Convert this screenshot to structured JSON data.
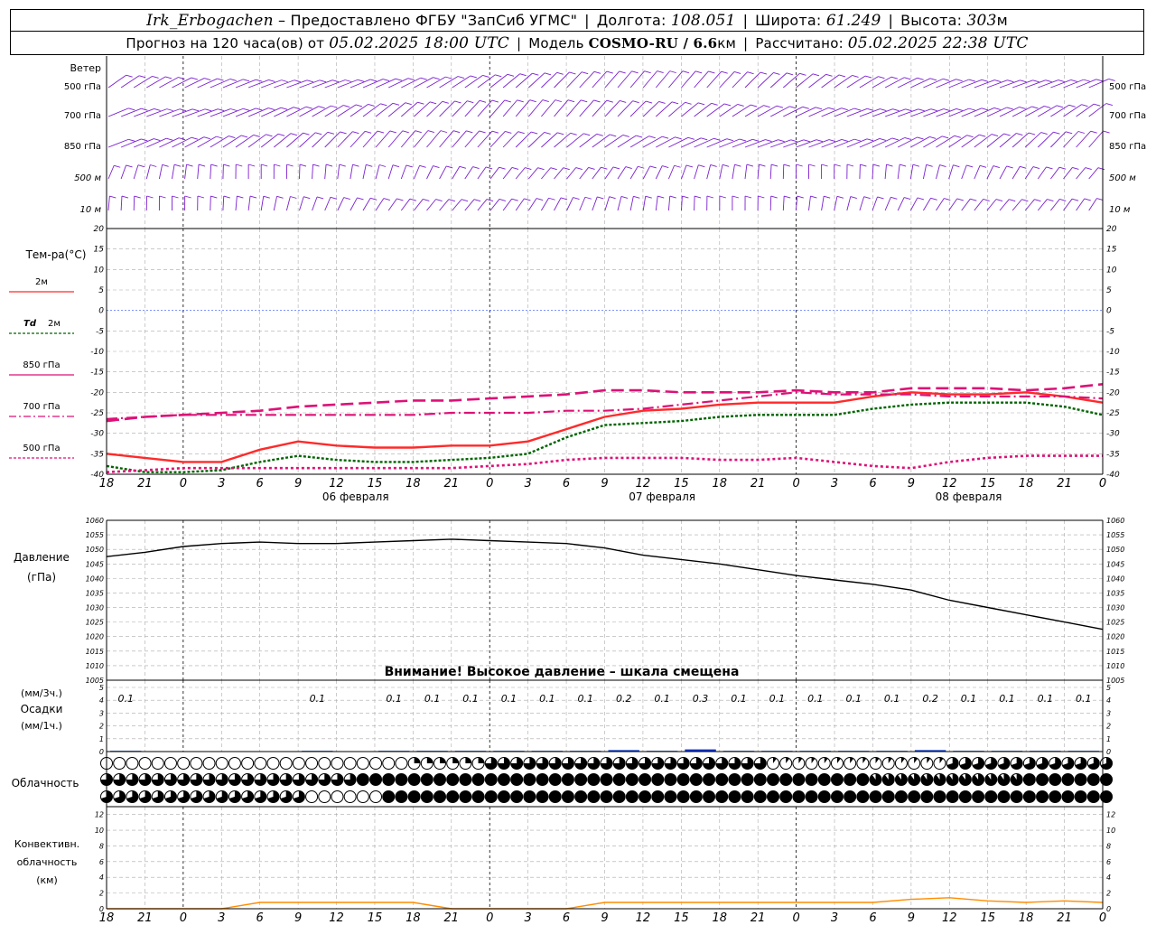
{
  "header": {
    "station": "Irk_Erbogachen",
    "provider": "– Предоставлено ФГБУ \"ЗапСиб УГМС\"",
    "lon_label": "Долгота:",
    "lon": "108.051",
    "lat_label": "Широта:",
    "lat": "61.249",
    "alt_label": "Высота:",
    "alt": "303",
    "alt_unit": "м",
    "forecast_label": "Прогноз на 120 часа(ов) от",
    "forecast_start": "05.02.2025 18:00 UTC",
    "model_label": "Модель",
    "model": "COSMO-RU / 6.6",
    "model_unit": "км",
    "computed_label": "Рассчитано:",
    "computed": "05.02.2025 22:38 UTC"
  },
  "labels": {
    "wind_title": "Ветер",
    "wind_levels": [
      "500 гПа",
      "700 гПа",
      "850 гПа",
      "500 м",
      "10  м"
    ],
    "temp_title": "Тем-ра(°C)",
    "temp_2m": "2м",
    "td_prefix": "Td",
    "td_suffix": "2м",
    "t850": "850 гПа",
    "t700": "700 гПа",
    "t500": "500 гПа",
    "pres_title1": "Давление",
    "pres_title2": "(гПа)",
    "pres_warning": "Внимание! Высокое давление – шкала смещена",
    "precip_title1": "(мм/3ч.)",
    "precip_title2": "Осадки",
    "precip_title3": "(мм/1ч.)",
    "cloud_title": "Облачность",
    "conv_title1": "Конвективн.",
    "conv_title2": "облачность",
    "conv_title3": "(км)"
  },
  "colors": {
    "t2m": "#ff2a2a",
    "td2m": "#006400",
    "t850": "#dd1177",
    "t700": "#dd1177",
    "t500": "#dd1177",
    "wind": "#7b1fd0",
    "pressure": "#000000",
    "precip": "#0033cc",
    "conv": "#ff8c00",
    "zero_line": "#3355ff"
  },
  "chart_data": [
    {
      "type": "line",
      "panel": "time_axis",
      "x_ticks": [
        "18",
        "21",
        "0",
        "3",
        "6",
        "9",
        "12",
        "15",
        "18",
        "21",
        "0",
        "3",
        "6",
        "9",
        "12",
        "15",
        "18",
        "21",
        "0",
        "3",
        "6",
        "9",
        "12",
        "15",
        "18",
        "21",
        "0"
      ],
      "day_labels": [
        "06 февраля",
        "07 февраля",
        "08 февраля"
      ]
    },
    {
      "type": "line",
      "panel": "temperature",
      "title": "Тем-ра(°C)",
      "ylim": [
        -40,
        20
      ],
      "y_ticks": [
        20,
        15,
        10,
        5,
        0,
        -5,
        -10,
        -15,
        -20,
        -25,
        -30,
        -35,
        -40
      ],
      "x_hours": [
        0,
        3,
        6,
        9,
        12,
        15,
        18,
        21,
        24,
        27,
        30,
        33,
        36,
        39,
        42,
        45,
        48,
        51,
        54,
        57,
        60,
        63,
        66,
        69,
        72,
        75,
        78
      ],
      "series": [
        {
          "name": "2м",
          "values": [
            -35,
            -36,
            -37,
            -37,
            -34,
            -32,
            -33,
            -33.5,
            -33.5,
            -33,
            -33,
            -32,
            -29,
            -26,
            -24.5,
            -24,
            -23,
            -22.5,
            -22.5,
            -22.5,
            -21,
            -20,
            -20.5,
            -20.5,
            -20,
            -21,
            -22.5
          ]
        },
        {
          "name": "Td 2м",
          "values": [
            -38,
            -39.5,
            -39.5,
            -39,
            -37,
            -35.5,
            -36.5,
            -37,
            -37,
            -36.5,
            -36,
            -35,
            -31,
            -28,
            -27.5,
            -27,
            -26,
            -25.5,
            -25.5,
            -25.5,
            -24,
            -23,
            -22.5,
            -22.5,
            -22.5,
            -23.5,
            -25.5
          ]
        },
        {
          "name": "850 гПа",
          "values": [
            -27,
            -26,
            -25.5,
            -25,
            -24.5,
            -23.5,
            -23,
            -22.5,
            -22,
            -22,
            -21.5,
            -21,
            -20.5,
            -19.5,
            -19.5,
            -20,
            -20,
            -20,
            -19.5,
            -20,
            -20,
            -19,
            -19,
            -19,
            -19.5,
            -19,
            -18
          ]
        },
        {
          "name": "700 гПа",
          "values": [
            -26.5,
            -26,
            -25.5,
            -25.5,
            -25.5,
            -25.5,
            -25.5,
            -25.5,
            -25.5,
            -25,
            -25,
            -25,
            -24.5,
            -24.5,
            -24,
            -23,
            -22,
            -21,
            -20,
            -20.5,
            -20.5,
            -20.5,
            -21,
            -21,
            -21,
            -21,
            -21.5
          ]
        },
        {
          "name": "500 гПа",
          "values": [
            -39.5,
            -39,
            -38.5,
            -38.5,
            -38.5,
            -38.5,
            -38.5,
            -38.5,
            -38.5,
            -38.5,
            -38,
            -37.5,
            -36.5,
            -36,
            -36,
            -36,
            -36.5,
            -36.5,
            -36,
            -37,
            -38,
            -38.5,
            -37,
            -36,
            -35.5,
            -35.5,
            -35.5
          ]
        }
      ]
    },
    {
      "type": "line",
      "panel": "pressure",
      "title": "Давление (гПа)",
      "ylim": [
        1005,
        1060
      ],
      "y_ticks": [
        1060,
        1055,
        1050,
        1045,
        1040,
        1035,
        1030,
        1025,
        1020,
        1015,
        1010,
        1005
      ],
      "x_hours": [
        0,
        3,
        6,
        9,
        12,
        15,
        18,
        21,
        24,
        27,
        30,
        33,
        36,
        39,
        42,
        45,
        48,
        51,
        54,
        57,
        60,
        63,
        66,
        69,
        72,
        75,
        78
      ],
      "series": [
        {
          "name": "pressure",
          "values": [
            1047.5,
            1049,
            1051,
            1052,
            1052.5,
            1052,
            1052,
            1052.5,
            1053,
            1053.5,
            1053,
            1052.5,
            1052,
            1050.5,
            1048,
            1046.5,
            1045,
            1043,
            1041,
            1039.5,
            1038,
            1036,
            1032.5,
            1030,
            1027.5,
            1025,
            1022.5
          ]
        }
      ]
    },
    {
      "type": "bar",
      "panel": "precipitation",
      "ylim": [
        0,
        5
      ],
      "y_ticks": [
        5,
        4,
        3,
        2,
        1,
        0
      ],
      "labels": [
        "0.1",
        "",
        "",
        "",
        "",
        "0.1",
        "",
        "0.1",
        "0.1",
        "0.1",
        "0.1",
        "0.1",
        "0.1",
        "0.2",
        "0.1",
        "0.3",
        "0.1",
        "0.1",
        "0.1",
        "0.1",
        "0.1",
        "0.2",
        "0.1",
        "0.1",
        "0.1",
        "0.1"
      ],
      "values": [
        0.1,
        0,
        0,
        0,
        0,
        0.1,
        0,
        0.1,
        0.1,
        0.1,
        0.1,
        0.1,
        0.1,
        0.2,
        0.1,
        0.3,
        0.1,
        0.1,
        0.1,
        0.1,
        0.1,
        0.2,
        0.1,
        0.1,
        0.1,
        0.1
      ]
    },
    {
      "type": "table",
      "panel": "cloudiness",
      "rows": [
        "low",
        "middle",
        "high"
      ],
      "note": "octa symbols per hour"
    },
    {
      "type": "area",
      "panel": "convective",
      "ylim": [
        0,
        13
      ],
      "y_ticks": [
        12,
        10,
        8,
        6,
        4,
        2,
        0
      ],
      "x_hours": [
        0,
        3,
        6,
        9,
        12,
        15,
        18,
        21,
        24,
        27,
        30,
        33,
        36,
        39,
        42,
        45,
        48,
        51,
        54,
        57,
        60,
        63,
        66,
        69,
        72,
        75,
        78
      ],
      "values": [
        0,
        0,
        0,
        0,
        0.8,
        0.8,
        0.8,
        0.8,
        0.8,
        0,
        0,
        0,
        0,
        0.8,
        0.8,
        0.8,
        0.8,
        0.8,
        0.8,
        0.8,
        0.8,
        1.2,
        1.4,
        1.0,
        0.8,
        1.0,
        0.8
      ]
    }
  ]
}
